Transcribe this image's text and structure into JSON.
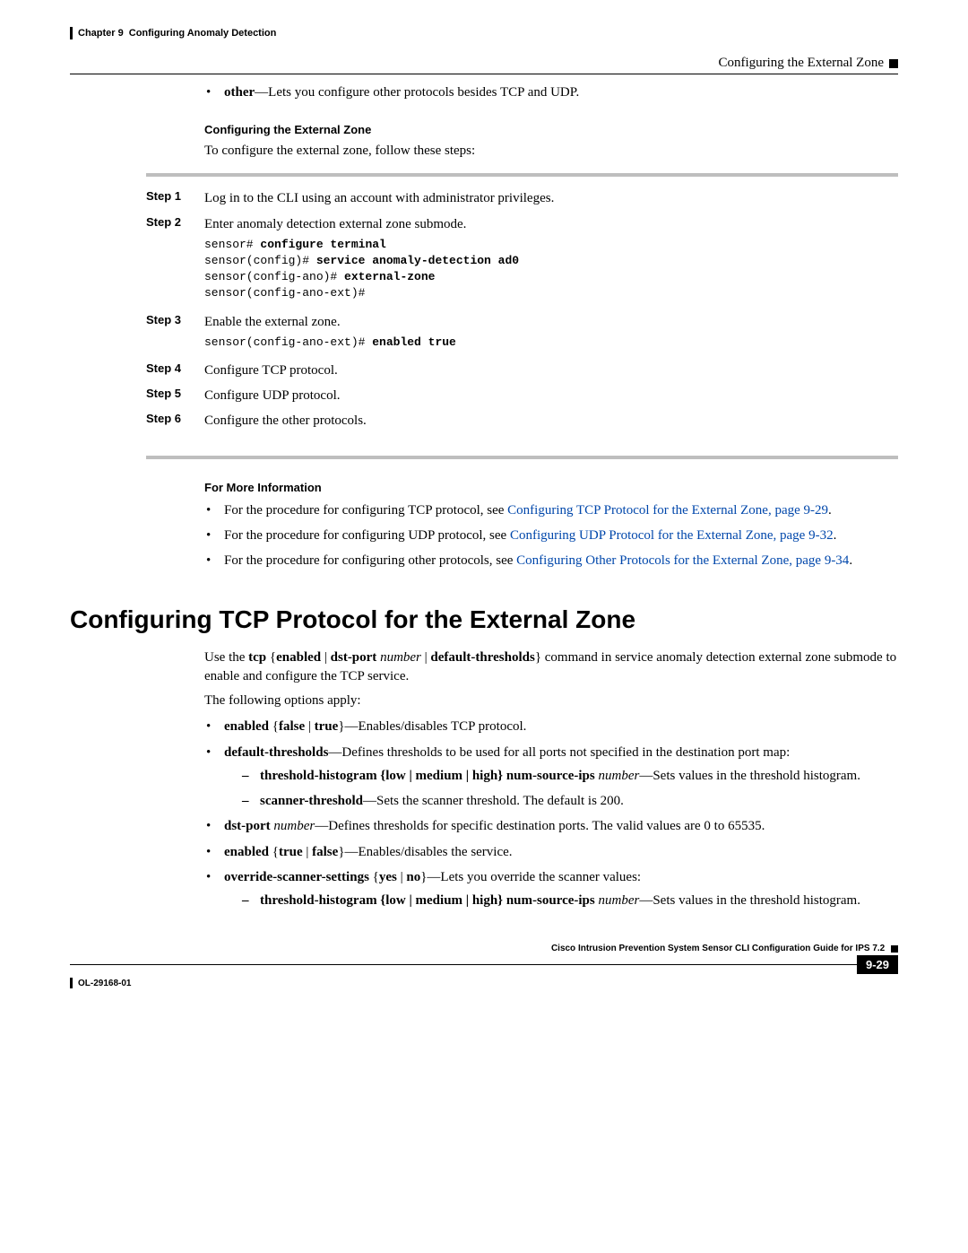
{
  "header": {
    "chapter": "Chapter 9",
    "chapterTitle": "Configuring Anomaly Detection",
    "sectionRight": "Configuring the External Zone"
  },
  "intro": {
    "otherBullet_b": "other",
    "otherBullet_rest": "—Lets you configure other protocols besides TCP and UDP."
  },
  "cfgZone": {
    "heading": "Configuring the External Zone",
    "lead": "To configure the external zone, follow these steps:"
  },
  "steps": {
    "s1": {
      "label": "Step 1",
      "text": "Log in to the CLI using an account with administrator privileges."
    },
    "s2": {
      "label": "Step 2",
      "text": "Enter anomaly detection external zone submode.",
      "code_p1": "sensor# ",
      "code_b1": "configure terminal",
      "code_p2": "sensor(config)# ",
      "code_b2": "service anomaly-detection ad0",
      "code_p3": "sensor(config-ano)# ",
      "code_b3": "external-zone",
      "code_p4": "sensor(config-ano-ext)# "
    },
    "s3": {
      "label": "Step 3",
      "text": "Enable the external zone.",
      "code_p1": "sensor(config-ano-ext)# ",
      "code_b1": "enabled true"
    },
    "s4": {
      "label": "Step 4",
      "text": "Configure TCP protocol."
    },
    "s5": {
      "label": "Step 5",
      "text": "Configure UDP protocol."
    },
    "s6": {
      "label": "Step 6",
      "text": "Configure the other protocols."
    }
  },
  "moreInfo": {
    "heading": "For More Information",
    "b1_pre": "For the procedure for configuring TCP protocol, see ",
    "b1_link": "Configuring TCP Protocol for the External Zone, page 9-29",
    "b2_pre": "For the procedure for configuring UDP protocol, see ",
    "b2_link": "Configuring UDP Protocol for the External Zone, page 9-32",
    "b3_pre": "For the procedure for configuring other protocols, see ",
    "b3_link": "Configuring Other Protocols for the External Zone, page 9-34"
  },
  "h1": "Configuring TCP Protocol for the External Zone",
  "tcp": {
    "p1_a": "Use the ",
    "p1_b1": "tcp",
    "p1_c1": " {",
    "p1_b2": "enabled",
    "p1_c2": " | ",
    "p1_b3": "dst-port",
    "p1_i1": " number",
    "p1_c3": " | ",
    "p1_b4": "default-thresholds",
    "p1_rest": "} command in service anomaly detection external zone submode to enable and configure the TCP service.",
    "p2": "The following options apply:",
    "opt1_b": "enabled",
    "opt1_c": " {",
    "opt1_b2": "false",
    "opt1_c2": " | ",
    "opt1_b3": "true",
    "opt1_rest": "}—Enables/disables TCP protocol.",
    "opt2_b": "default-thresholds",
    "opt2_rest": "—Defines thresholds to be used for all ports not specified in the destination port map:",
    "opt2a_b": "threshold-histogram {low | medium | high} num-source-ips",
    "opt2a_i": " number",
    "opt2a_rest": "—Sets values in the threshold histogram.",
    "opt2b_b": "scanner-threshold",
    "opt2b_rest": "—Sets the scanner threshold. The default is 200.",
    "opt3_b": "dst-port",
    "opt3_i": " number",
    "opt3_rest": "—Defines thresholds for specific destination ports. The valid values are 0 to 65535.",
    "opt4_b": "enabled",
    "opt4_c": " {",
    "opt4_b2": "true",
    "opt4_c2": " | ",
    "opt4_b3": "false",
    "opt4_rest": "}—Enables/disables the service.",
    "opt5_b": "override-scanner-settings",
    "opt5_c": " {",
    "opt5_b2": "yes",
    "opt5_c2": " | ",
    "opt5_b3": "no",
    "opt5_rest": "}—Lets you override the scanner values:",
    "opt5a_b": "threshold-histogram {low | medium | high} num-source-ips",
    "opt5a_i": " number",
    "opt5a_rest": "—Sets values in the threshold histogram."
  },
  "footer": {
    "guide": "Cisco Intrusion Prevention System Sensor CLI Configuration Guide for IPS 7.2",
    "docid": "OL-29168-01",
    "page": "9-29"
  }
}
